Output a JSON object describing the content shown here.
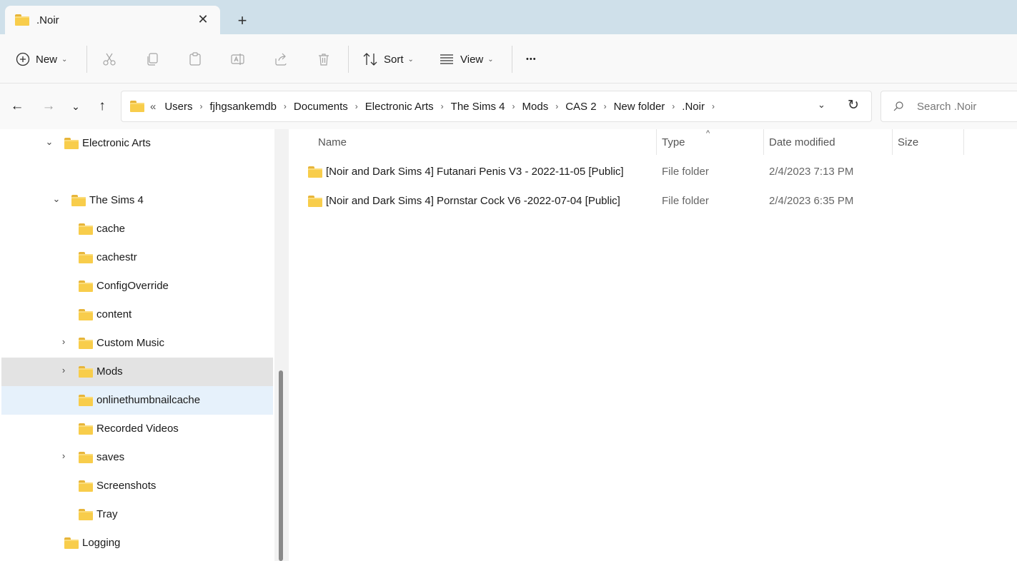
{
  "tab": {
    "title": ".Noir",
    "close_glyph": "✕",
    "new_glyph": "+"
  },
  "toolbar": {
    "new_label": "New",
    "sort_label": "Sort",
    "view_label": "View",
    "more_glyph": "•••"
  },
  "address": {
    "overflow": "«",
    "crumbs": [
      "Users",
      "fjhgsankemdb",
      "Documents",
      "Electronic Arts",
      "The Sims 4",
      "Mods",
      "CAS 2",
      "New folder",
      ".Noir"
    ]
  },
  "search": {
    "placeholder": "Search .Noir"
  },
  "nav": {
    "items": [
      {
        "label": "Electronic Arts",
        "expander": "⌄"
      },
      {
        "label": "The Sims 4",
        "expander": "⌄"
      },
      {
        "label": "cache",
        "expander": ""
      },
      {
        "label": "cachestr",
        "expander": ""
      },
      {
        "label": "ConfigOverride",
        "expander": ""
      },
      {
        "label": "content",
        "expander": ""
      },
      {
        "label": "Custom Music",
        "expander": "›"
      },
      {
        "label": "Mods",
        "expander": "›"
      },
      {
        "label": "onlinethumbnailcache",
        "expander": ""
      },
      {
        "label": "Recorded Videos",
        "expander": ""
      },
      {
        "label": "saves",
        "expander": "›"
      },
      {
        "label": "Screenshots",
        "expander": ""
      },
      {
        "label": "Tray",
        "expander": ""
      },
      {
        "label": "Logging",
        "expander": ""
      }
    ]
  },
  "columns": {
    "name": "Name",
    "type": "Type",
    "date": "Date modified",
    "size": "Size",
    "sort_caret": "^"
  },
  "files": [
    {
      "name": "[Noir and Dark Sims 4] Futanari Penis V3 - 2022-11-05 [Public]",
      "type": "File folder",
      "date": "2/4/2023 7:13 PM"
    },
    {
      "name": "[Noir and Dark Sims 4] Pornstar Cock V6 -2022-07-04 [Public]",
      "type": "File folder",
      "date": "2/4/2023 6:35 PM"
    }
  ],
  "icons": [
    "folder-icon",
    "close-icon",
    "plus-icon",
    "new-icon",
    "cut-icon",
    "copy-icon",
    "paste-icon",
    "rename-icon",
    "share-icon",
    "delete-icon",
    "sort-icon",
    "view-icon",
    "more-icon",
    "back-icon",
    "forward-icon",
    "recent-icon",
    "up-icon",
    "chevron-down-icon",
    "refresh-icon",
    "search-icon"
  ]
}
